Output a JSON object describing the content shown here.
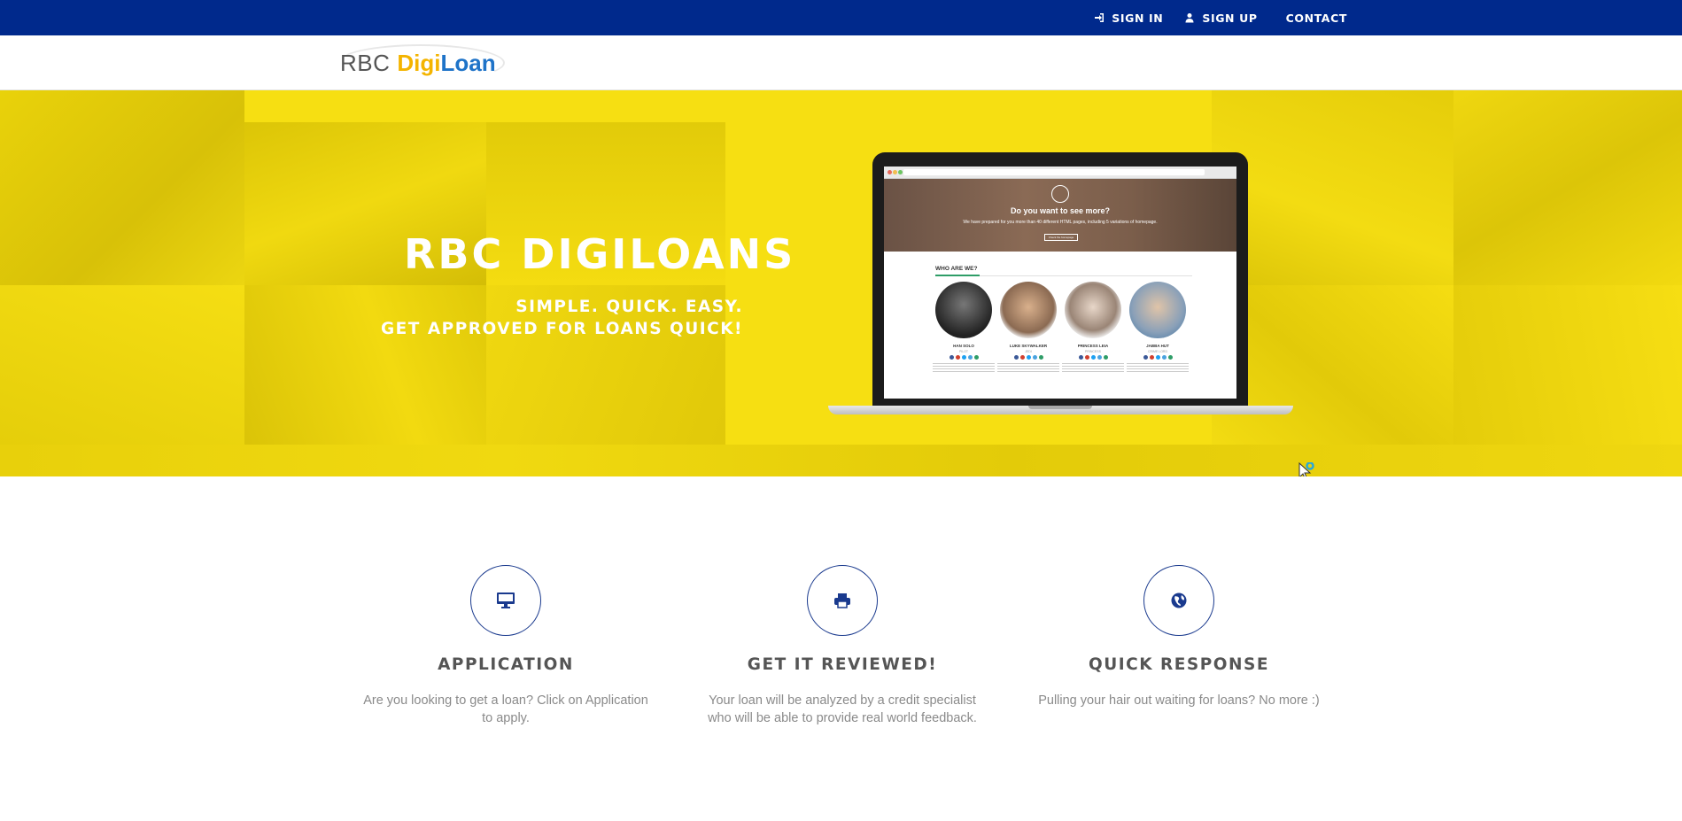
{
  "topnav": {
    "signin_label": "SIGN IN",
    "signup_label": "SIGN UP",
    "contact_label": "CONTACT"
  },
  "logo": {
    "part1": "RBC",
    "part2": "Digi",
    "part3": "Loan"
  },
  "hero": {
    "title": "RBC DIGILOANS",
    "subtitle_line1": "SIMPLE. QUICK. EASY.",
    "subtitle_line2": "GET APPROVED FOR LOANS QUICK!",
    "background_color": "#f6df12"
  },
  "laptop_screen": {
    "headline": "Do you want to see more?",
    "subline": "We have prepared for you more than 40 different HTML pages, including 5 variations of homepage.",
    "button_label": "Check the homepage",
    "section_title": "WHO ARE WE?",
    "people": [
      {
        "name": "HAN SOLO",
        "role": "PILOT"
      },
      {
        "name": "LUKE SKYWALKER",
        "role": "JEDI"
      },
      {
        "name": "PRINCESS LEIA",
        "role": "PRINCESS"
      },
      {
        "name": "JABBA HUT",
        "role": "CRIME LORD"
      }
    ]
  },
  "features": [
    {
      "icon": "desktop-icon",
      "title": "APPLICATION",
      "text": "Are you looking to get a loan? Click on Application to apply."
    },
    {
      "icon": "print-icon",
      "title": "GET IT REVIEWED!",
      "text": "Your loan will be analyzed by a credit specialist who will be able to provide real world feedback."
    },
    {
      "icon": "globe-icon",
      "title": "QUICK RESPONSE",
      "text": "Pulling your hair out waiting for loans? No more :)"
    }
  ],
  "colors": {
    "topbar": "#00298c",
    "accent_yellow": "#f6df12",
    "icon_navy": "#1a3a8e"
  }
}
